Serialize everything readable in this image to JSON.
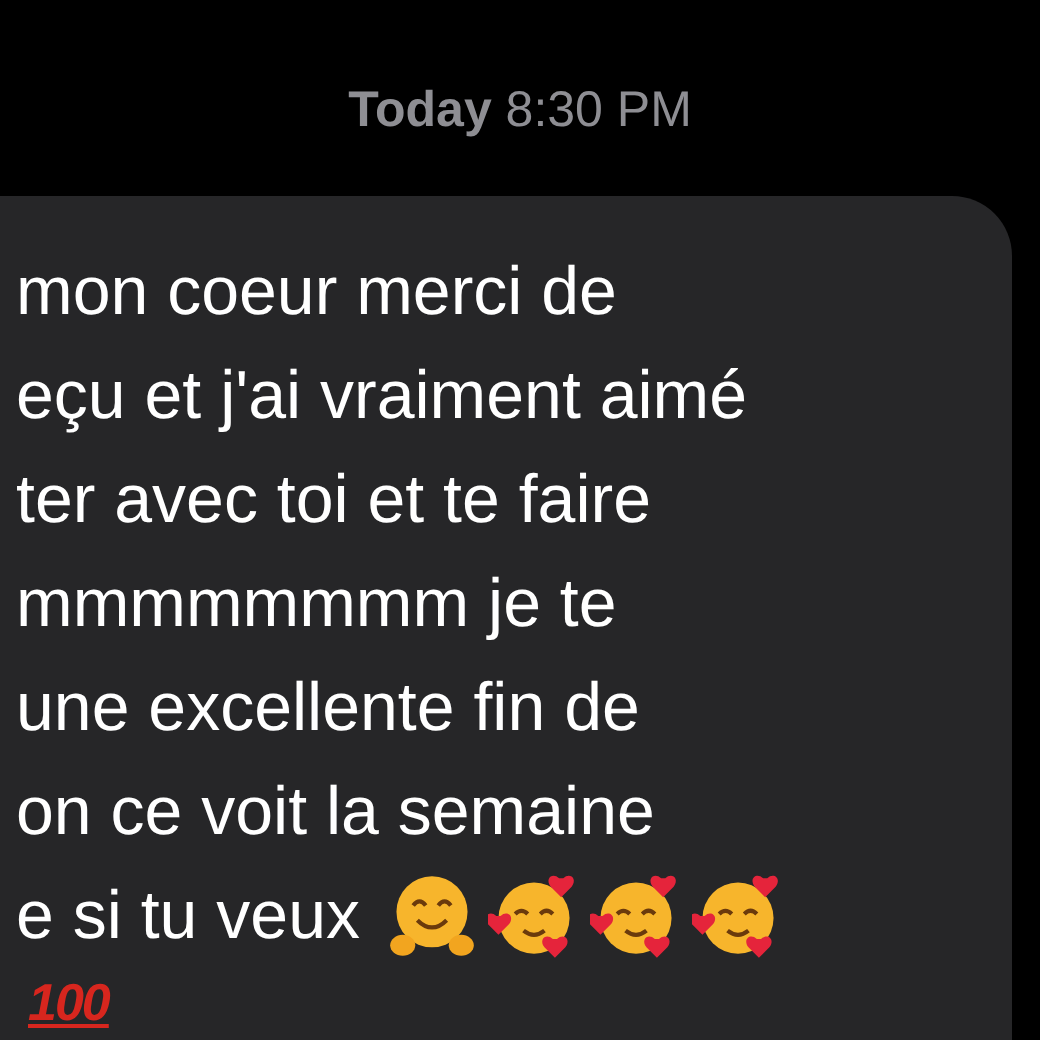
{
  "timestamp": "**Today** 8:30 PM",
  "message": {
    "lines": [
      "mon coeur merci de",
      "eçu et j'ai vraiment aimé",
      "ter avec toi et te faire",
      "mmmmmmmm je te",
      "une excellente fin de",
      "on ce voit la semaine",
      "e si tu veux"
    ],
    "emojis": [
      {
        "kind": "hug"
      },
      {
        "kind": "hearts"
      },
      {
        "kind": "hearts"
      },
      {
        "kind": "hearts"
      }
    ],
    "reaction": "100"
  }
}
